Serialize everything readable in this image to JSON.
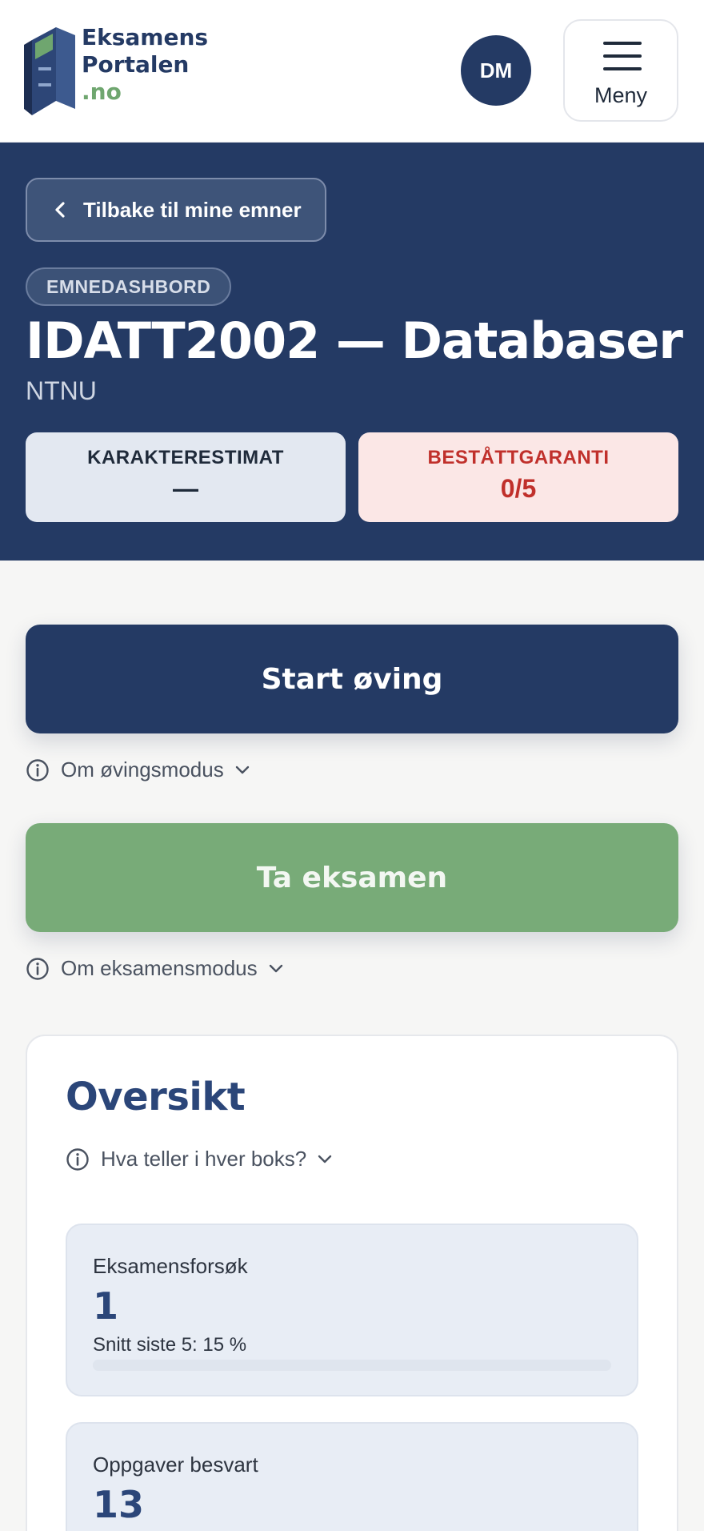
{
  "header": {
    "logo_line1": "Eksamens",
    "logo_line2": "Portalen",
    "logo_tld": ".no",
    "avatar_initials": "DM",
    "menu_label": "Meny"
  },
  "hero": {
    "back_label": "Tilbake til mine emner",
    "chip_label": "EMNEDASHBORD",
    "title": "IDATT2002 — Databaser",
    "school": "NTNU",
    "grade_label": "KARAKTERESTIMAT",
    "grade_value": "—",
    "guarantee_label": "BESTÅTTGARANTI",
    "guarantee_value": "0/5"
  },
  "actions": {
    "practice_label": "Start øving",
    "practice_info": "Om øvingsmodus",
    "exam_label": "Ta eksamen",
    "exam_info": "Om eksamensmodus"
  },
  "overview": {
    "title": "Oversikt",
    "info": "Hva teller i hver boks?",
    "metrics": [
      {
        "label": "Eksamensforsøk",
        "value": "1",
        "sub": "Snitt siste 5: 15 %",
        "progress": 0.15
      },
      {
        "label": "Oppgaver besvart",
        "value": "13"
      }
    ]
  },
  "colors": {
    "navy": "#243a64",
    "green": "#78ab78",
    "danger": "#c0302b"
  },
  "icons": [
    "logo-book-icon",
    "menu-icon",
    "chevron-left-icon",
    "info-icon",
    "chevron-down-icon"
  ]
}
